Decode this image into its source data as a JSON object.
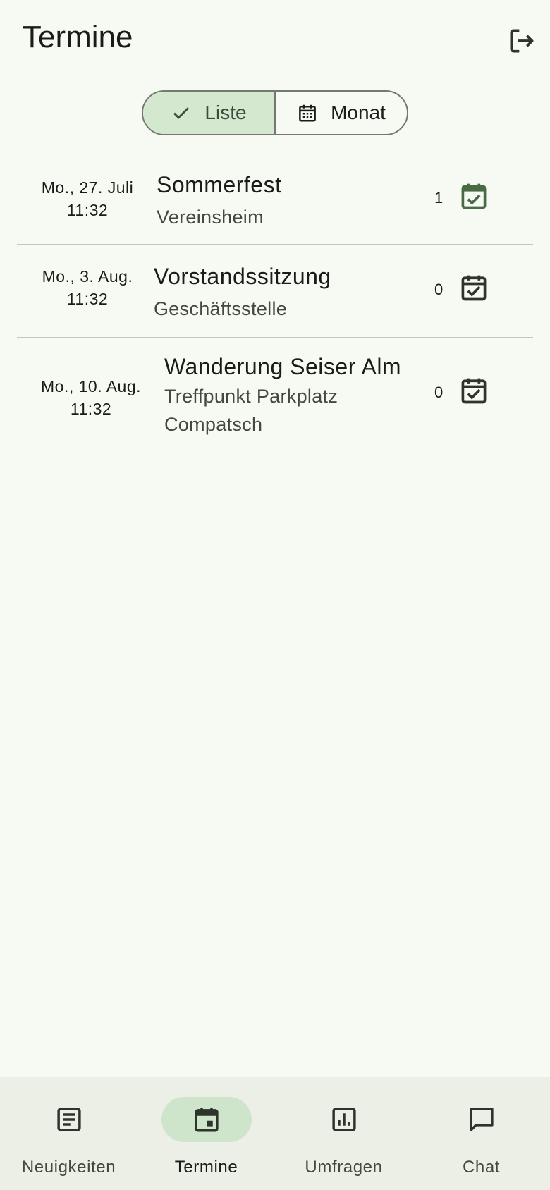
{
  "header": {
    "title": "Termine",
    "logout_icon": "logout-icon"
  },
  "view_toggle": {
    "options": [
      {
        "label": "Liste",
        "icon": "check-icon",
        "selected": true
      },
      {
        "label": "Monat",
        "icon": "calendar-month-icon",
        "selected": false
      }
    ]
  },
  "events": [
    {
      "date": "Mo., 27. Juli",
      "time": "11:32",
      "title": "Sommerfest",
      "location_lines": [
        "Vereinsheim"
      ],
      "count": "1",
      "icon": "event-available-icon",
      "highlighted": true
    },
    {
      "date": "Mo., 3. Aug.",
      "time": "11:32",
      "title": "Vorstandssitzung",
      "location_lines": [
        "Geschäftsstelle"
      ],
      "count": "0",
      "icon": "event-available-icon",
      "highlighted": false
    },
    {
      "date": "Mo., 10. Aug.",
      "time": "11:32",
      "title": "Wanderung Seiser Alm",
      "location_lines": [
        "Treffpunkt Parkplatz",
        "Compatsch"
      ],
      "count": "0",
      "icon": "event-available-icon",
      "highlighted": false
    }
  ],
  "bottom_nav": {
    "items": [
      {
        "label": "Neuigkeiten",
        "icon": "article-icon",
        "active": false
      },
      {
        "label": "Termine",
        "icon": "event-icon",
        "active": true
      },
      {
        "label": "Umfragen",
        "icon": "poll-icon",
        "active": false
      },
      {
        "label": "Chat",
        "icon": "chat-bubble-icon",
        "active": false
      }
    ]
  },
  "colors": {
    "background": "#f7faf2",
    "selected_segment": "#d3e8cf",
    "highlight_icon": "#4a6a44",
    "nav_background": "#ecefe6",
    "nav_active_pill": "#cfe5cb"
  }
}
